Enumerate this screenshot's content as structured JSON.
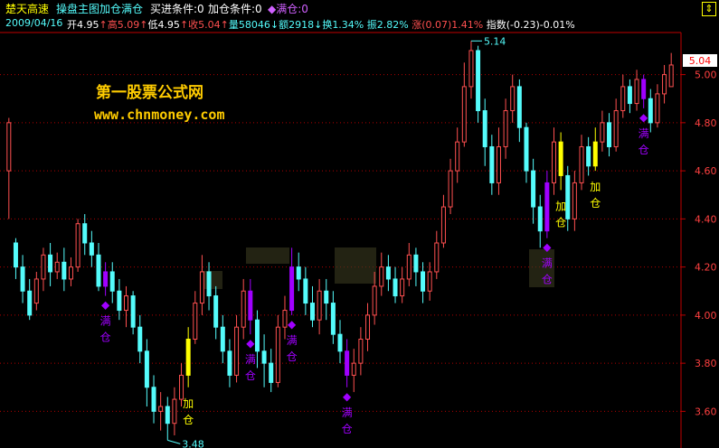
{
  "header": {
    "stock_name": "楚天高速",
    "chart_title": "操盘主图加仓满仓",
    "buy_label": "买进条件:0",
    "add_label": "加仓条件:0",
    "full_label": "◆满仓:0",
    "date": "2009/04/16",
    "open_label": "开",
    "open_value": "4.95",
    "high_label": "高",
    "high_value": "5.09",
    "low_label": "低",
    "low_value": "4.95",
    "close_label": "收",
    "close_value": "5.04",
    "volume_label": "量",
    "volume_value": "58046",
    "amount_label": "额",
    "amount_value": "2918",
    "turnover_label": "换",
    "turnover_value": "1.34%",
    "amplitude_label": "振",
    "amplitude_value": "2.82%",
    "change_label": "涨",
    "change_value": "(0.07)",
    "change_pct": "1.41%",
    "index_label": "指数",
    "index_value": "(-0.23)",
    "index_pct": "-0.01%"
  },
  "watermark": {
    "line1": "第一股票公式网",
    "line2": "www.chnmoney.com"
  },
  "price_box": "5.04",
  "icons": {
    "corner": "up-down-arrow-icon"
  },
  "colors": {
    "up": "#ff5050",
    "down": "#54fcfc",
    "axis": "#c00000",
    "grid": "#b00000",
    "add": "#ffff00",
    "full": "#a000ff",
    "header_yellow": "#ffff00",
    "header_cyan": "#54fcfc"
  },
  "chart_data": {
    "type": "candlestick",
    "y_ticks": [
      "5.00",
      "4.80",
      "4.60",
      "4.40",
      "4.20",
      "4.00",
      "3.80",
      "3.60"
    ],
    "ylim": [
      3.47,
      5.16
    ],
    "max_label": "5.14",
    "min_label": "3.48",
    "markers": {
      "add_text": [
        "加",
        "仓"
      ],
      "full_text": [
        "满",
        "仓"
      ],
      "symbol": "◆"
    },
    "candles": [
      [
        4.6,
        4.8,
        4.82,
        4.4
      ],
      [
        4.3,
        4.2,
        4.32,
        4.15
      ],
      [
        4.2,
        4.1,
        4.25,
        4.05
      ],
      [
        4.1,
        4.0,
        4.15,
        3.98
      ],
      [
        4.05,
        4.15,
        4.18,
        4.02
      ],
      [
        4.15,
        4.25,
        4.28,
        4.1
      ],
      [
        4.25,
        4.18,
        4.3,
        4.12
      ],
      [
        4.18,
        4.22,
        4.26,
        4.15
      ],
      [
        4.22,
        4.15,
        4.28,
        4.1
      ],
      [
        4.15,
        4.2,
        4.24,
        4.12
      ],
      [
        4.2,
        4.38,
        4.4,
        4.18
      ],
      [
        4.38,
        4.3,
        4.42,
        4.25
      ],
      [
        4.3,
        4.25,
        4.35,
        4.2
      ],
      [
        4.25,
        4.12,
        4.3,
        4.1
      ],
      [
        4.12,
        4.18,
        4.22,
        4.08
      ],
      [
        4.18,
        4.1,
        4.22,
        4.05
      ],
      [
        4.1,
        4.02,
        4.15,
        3.98
      ],
      [
        4.02,
        4.08,
        4.12,
        3.95
      ],
      [
        4.08,
        3.95,
        4.1,
        3.92
      ],
      [
        3.95,
        3.85,
        4.0,
        3.8
      ],
      [
        3.85,
        3.7,
        3.9,
        3.62
      ],
      [
        3.7,
        3.6,
        3.75,
        3.55
      ],
      [
        3.6,
        3.62,
        3.68,
        3.52
      ],
      [
        3.62,
        3.55,
        3.66,
        3.48
      ],
      [
        3.55,
        3.65,
        3.7,
        3.5
      ],
      [
        3.65,
        3.75,
        3.8,
        3.62
      ],
      [
        3.75,
        3.9,
        3.95,
        3.7
      ],
      [
        3.9,
        4.05,
        4.1,
        3.88
      ],
      [
        4.05,
        4.18,
        4.25,
        4.0
      ],
      [
        4.18,
        4.08,
        4.22,
        4.02
      ],
      [
        4.08,
        3.95,
        4.12,
        3.9
      ],
      [
        3.95,
        3.85,
        4.0,
        3.8
      ],
      [
        3.85,
        3.75,
        3.9,
        3.7
      ],
      [
        3.75,
        3.95,
        4.0,
        3.72
      ],
      [
        3.95,
        4.1,
        4.15,
        3.9
      ],
      [
        4.1,
        3.98,
        4.15,
        3.92
      ],
      [
        3.98,
        3.85,
        4.02,
        3.78
      ],
      [
        3.85,
        3.8,
        3.92,
        3.7
      ],
      [
        3.8,
        3.72,
        3.86,
        3.68
      ],
      [
        3.72,
        3.95,
        4.0,
        3.7
      ],
      [
        3.95,
        4.02,
        4.08,
        3.9
      ],
      [
        4.02,
        4.2,
        4.28,
        4.0
      ],
      [
        4.2,
        4.15,
        4.26,
        4.1
      ],
      [
        4.15,
        4.05,
        4.2,
        4.0
      ],
      [
        4.05,
        3.98,
        4.12,
        3.95
      ],
      [
        3.98,
        4.1,
        4.15,
        3.92
      ],
      [
        4.1,
        4.05,
        4.15,
        3.98
      ],
      [
        4.05,
        3.92,
        4.1,
        3.88
      ],
      [
        3.92,
        3.85,
        3.98,
        3.8
      ],
      [
        3.85,
        3.75,
        3.9,
        3.7
      ],
      [
        3.75,
        3.8,
        3.86,
        3.68
      ],
      [
        3.8,
        3.9,
        3.95,
        3.75
      ],
      [
        3.9,
        4.0,
        4.05,
        3.85
      ],
      [
        4.0,
        4.12,
        4.18,
        3.96
      ],
      [
        4.12,
        4.2,
        4.26,
        4.08
      ],
      [
        4.2,
        4.15,
        4.25,
        4.1
      ],
      [
        4.15,
        4.08,
        4.2,
        4.05
      ],
      [
        4.08,
        4.15,
        4.2,
        4.05
      ],
      [
        4.15,
        4.25,
        4.3,
        4.12
      ],
      [
        4.25,
        4.18,
        4.28,
        4.12
      ],
      [
        4.18,
        4.1,
        4.22,
        4.05
      ],
      [
        4.1,
        4.18,
        4.22,
        4.06
      ],
      [
        4.18,
        4.3,
        4.35,
        4.15
      ],
      [
        4.3,
        4.45,
        4.5,
        4.28
      ],
      [
        4.45,
        4.6,
        4.65,
        4.42
      ],
      [
        4.6,
        4.72,
        4.78,
        4.55
      ],
      [
        4.72,
        4.95,
        5.05,
        4.7
      ],
      [
        4.95,
        5.1,
        5.14,
        4.9
      ],
      [
        5.1,
        4.85,
        5.12,
        4.8
      ],
      [
        4.85,
        4.7,
        4.9,
        4.62
      ],
      [
        4.7,
        4.55,
        4.75,
        4.5
      ],
      [
        4.55,
        4.7,
        4.78,
        4.5
      ],
      [
        4.7,
        4.85,
        4.9,
        4.65
      ],
      [
        4.85,
        4.95,
        5.0,
        4.8
      ],
      [
        4.95,
        4.78,
        4.98,
        4.72
      ],
      [
        4.78,
        4.6,
        4.8,
        4.55
      ],
      [
        4.6,
        4.45,
        4.65,
        4.38
      ],
      [
        4.45,
        4.35,
        4.5,
        4.28
      ],
      [
        4.35,
        4.55,
        4.6,
        4.32
      ],
      [
        4.55,
        4.72,
        4.78,
        4.5
      ],
      [
        4.72,
        4.58,
        4.76,
        4.52
      ],
      [
        4.58,
        4.4,
        4.62,
        4.35
      ],
      [
        4.4,
        4.55,
        4.6,
        4.35
      ],
      [
        4.55,
        4.7,
        4.75,
        4.52
      ],
      [
        4.7,
        4.62,
        4.74,
        4.58
      ],
      [
        4.62,
        4.72,
        4.78,
        4.6
      ],
      [
        4.72,
        4.8,
        4.85,
        4.68
      ],
      [
        4.8,
        4.7,
        4.84,
        4.66
      ],
      [
        4.7,
        4.85,
        4.9,
        4.68
      ],
      [
        4.85,
        4.95,
        5.0,
        4.82
      ],
      [
        4.95,
        4.88,
        4.98,
        4.84
      ],
      [
        4.88,
        4.98,
        5.02,
        4.85
      ],
      [
        4.98,
        4.9,
        5.0,
        4.86
      ],
      [
        4.9,
        4.8,
        4.94,
        4.76
      ],
      [
        4.8,
        4.92,
        4.96,
        4.78
      ],
      [
        4.92,
        5.0,
        5.04,
        4.88
      ],
      [
        4.95,
        5.04,
        5.09,
        4.95
      ]
    ],
    "highlight": {
      "add_indices": [
        26,
        80,
        85
      ],
      "full_indices": [
        14,
        35,
        41,
        49,
        78,
        92
      ]
    }
  }
}
